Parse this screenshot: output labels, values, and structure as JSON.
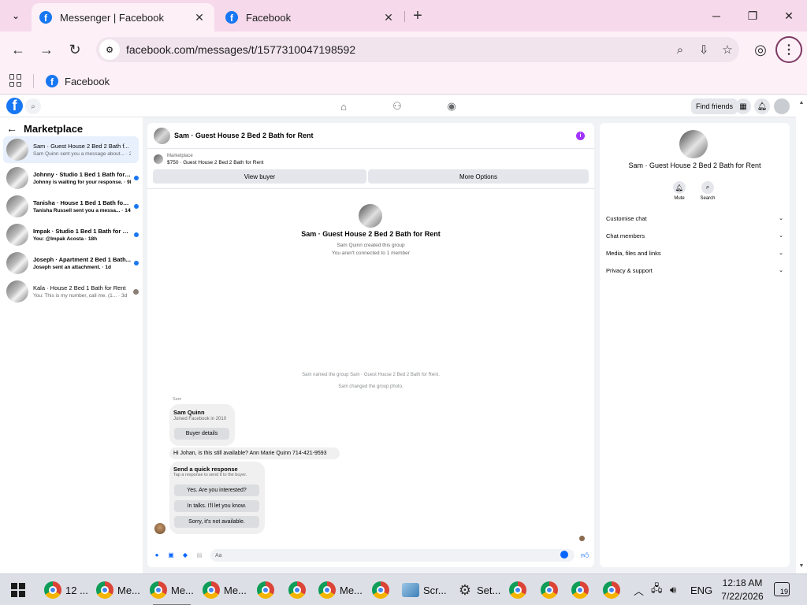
{
  "browser": {
    "tabs": [
      {
        "title": "Messenger | Facebook",
        "active": true
      },
      {
        "title": "Facebook",
        "active": false
      }
    ],
    "url": "facebook.com/messages/t/1577310047198592",
    "bookmark": "Facebook"
  },
  "fb": {
    "find_friends": "Find friends"
  },
  "left": {
    "heading": "Marketplace",
    "chats": [
      {
        "title": "Sam · Guest House 2 Bed 2 Bath f...",
        "sub": "Sam Quinn sent you a message about... · 2h",
        "unread": false,
        "selected": true
      },
      {
        "title": "Johnny · Studio 1 Bed 1 Bath for ...",
        "sub": "Johnny is waiting for your response. · 9h",
        "unread": true,
        "selected": false
      },
      {
        "title": "Tanisha · House 1 Bed 1 Bath for ...",
        "sub": "Tanisha Russell sent you a messa... · 14h",
        "unread": true,
        "selected": false
      },
      {
        "title": "Impak · Studio 1 Bed 1 Bath for R...",
        "sub": "You: @Impak Acosta · 18h",
        "unread": true,
        "selected": false
      },
      {
        "title": "Joseph · Apartment 2 Bed 1 Bath...",
        "sub": "Joseph sent an attachment. · 1d",
        "unread": true,
        "selected": false
      },
      {
        "title": "Kala · House 2 Bed 1 Bath for Rent",
        "sub": "You: This is my number, call me. (1... · 3d",
        "unread": false,
        "selected": false
      }
    ]
  },
  "convo": {
    "title": "Sam · Guest House 2 Bed 2 Bath for Rent",
    "marketplace_label": "Marketplace",
    "listing": "$750 · Guest House 2 Bed 2 Bath for Rent",
    "view_buyer": "View buyer",
    "more_options": "More Options",
    "group_name": "Sam · Guest House 2 Bed 2 Bath for Rent",
    "created": "Sam Quinn created this group",
    "connected": "You aren't connected to 1 member",
    "renamed": "Sam named the group Sam · Guest House 2 Bed 2 Bath for Rent.",
    "changed_photo": "Sam changed the group photo.",
    "sender": "Sam",
    "profile_name": "Sam Quinn",
    "profile_sub": "Joined Facebook in 2010",
    "buyer_details": "Buyer details",
    "message": "Hi Johan, is this still available? Ann Marie Quinn 714-421-9593",
    "quick_title": "Send a quick response",
    "quick_sub": "Tap a response to send it to the buyer.",
    "quick_replies": [
      "Yes. Are you interested?",
      "In talks. I'll let you know.",
      "Sorry, it's not available."
    ],
    "composer_placeholder": "Aa"
  },
  "right": {
    "name": "Sam · Guest House 2 Bed 2 Bath for Rent",
    "mute": "Mute",
    "search": "Search",
    "sections": [
      "Customise chat",
      "Chat members",
      "Media, files and links",
      "Privacy & support"
    ]
  },
  "taskbar": {
    "apps": [
      "12 ...",
      "Me...",
      "Me...",
      "Me...",
      "",
      "",
      "Me...",
      "",
      "Scr...",
      "Set...",
      "",
      "",
      "",
      ""
    ],
    "lang": "ENG",
    "time": "12:18 AM",
    "date": "7/22/2026",
    "notifications": "19"
  },
  "colors": {
    "fb_blue": "#1877f2",
    "selected_chat": "#e7f0fc",
    "tabstrip": "#f6d9ea"
  }
}
